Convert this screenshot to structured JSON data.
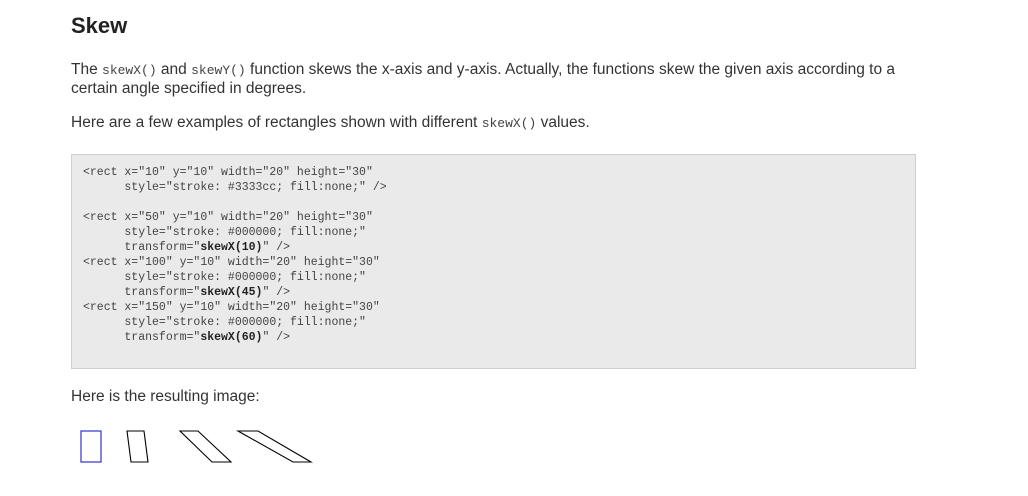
{
  "heading": "Skew",
  "para1": {
    "t1": "The ",
    "code1": "skewX()",
    "t2": " and ",
    "code2": "skewY()",
    "t3": " function skews the x-axis and y-axis. Actually, the functions skew the given axis according to a certain angle specified in degrees."
  },
  "para2": {
    "t1": "Here are a few examples of rectangles shown with different ",
    "code1": "skewX()",
    "t2": " values."
  },
  "code": {
    "r1a": "<rect x=\"10\" y=\"10\" width=\"20\" height=\"30\"",
    "r1b": "      style=\"stroke: #3333cc; fill:none;\" />",
    "r2a": "<rect x=\"50\" y=\"10\" width=\"20\" height=\"30\"",
    "r2b": "      style=\"stroke: #000000; fill:none;\"",
    "r2c_pre": "      transform=\"",
    "r2c_bold": "skewX(10)",
    "r2c_post": "\" />",
    "r3a": "<rect x=\"100\" y=\"10\" width=\"20\" height=\"30\"",
    "r3b": "      style=\"stroke: #000000; fill:none;\"",
    "r3c_pre": "      transform=\"",
    "r3c_bold": "skewX(45)",
    "r3c_post": "\" />",
    "r4a": "<rect x=\"150\" y=\"10\" width=\"20\" height=\"30\"",
    "r4b": "      style=\"stroke: #000000; fill:none;\"",
    "r4c_pre": "      transform=\"",
    "r4c_bold": "skewX(60)",
    "r4c_post": "\" />"
  },
  "para3": "Here is the resulting image:",
  "colors": {
    "rect_blue": "#3333cc",
    "rect_black": "#000000"
  }
}
